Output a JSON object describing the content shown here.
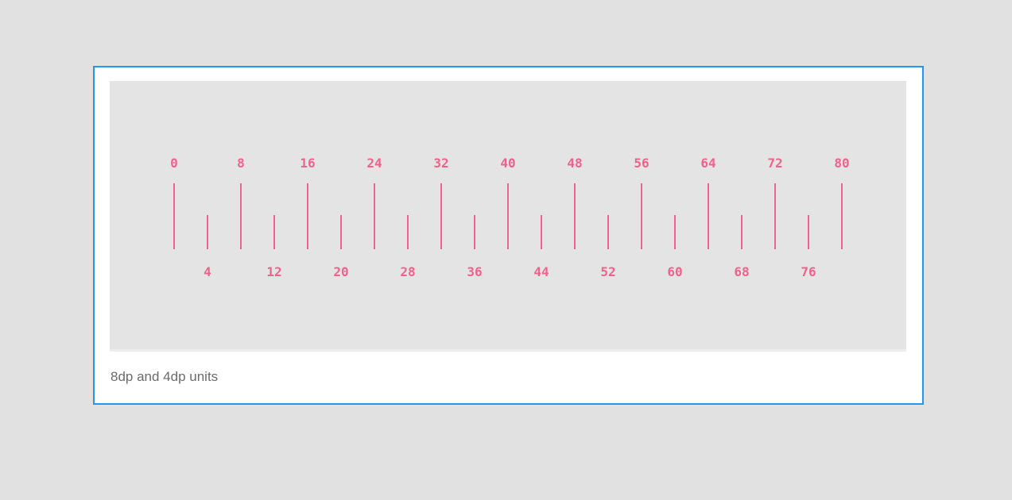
{
  "figure": {
    "caption": "8dp and 4dp units",
    "accent_color": "#f0628e",
    "frame_color": "#2196f3"
  },
  "chart_data": {
    "type": "ruler",
    "unit": "dp",
    "major_step": 8,
    "minor_step": 4,
    "range": [
      0,
      80
    ],
    "major_ticks": [
      "0",
      "8",
      "16",
      "24",
      "32",
      "40",
      "48",
      "56",
      "64",
      "72",
      "80"
    ],
    "minor_ticks": [
      "4",
      "12",
      "20",
      "28",
      "36",
      "44",
      "52",
      "60",
      "68",
      "76"
    ]
  }
}
